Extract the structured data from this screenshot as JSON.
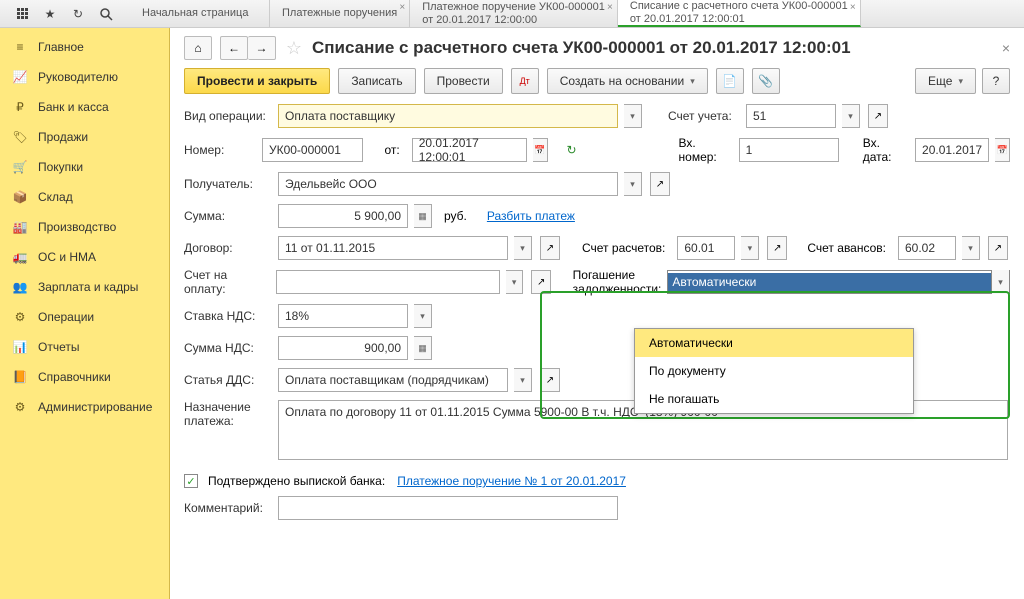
{
  "tabs": [
    {
      "line1": "Начальная страница"
    },
    {
      "line1": "Платежные поручения"
    },
    {
      "line1": "Платежное поручение УК00-000001",
      "line2": "от 20.01.2017 12:00:00"
    },
    {
      "line1": "Списание с расчетного счета УК00-000001",
      "line2": "от 20.01.2017 12:00:01"
    }
  ],
  "sidebar": [
    {
      "label": "Главное"
    },
    {
      "label": "Руководителю"
    },
    {
      "label": "Банк и касса"
    },
    {
      "label": "Продажи"
    },
    {
      "label": "Покупки"
    },
    {
      "label": "Склад"
    },
    {
      "label": "Производство"
    },
    {
      "label": "ОС и НМА"
    },
    {
      "label": "Зарплата и кадры"
    },
    {
      "label": "Операции"
    },
    {
      "label": "Отчеты"
    },
    {
      "label": "Справочники"
    },
    {
      "label": "Администрирование"
    }
  ],
  "title": "Списание с расчетного счета УК00-000001 от 20.01.2017 12:00:01",
  "toolbar": {
    "post_close": "Провести и закрыть",
    "save": "Записать",
    "post": "Провести",
    "create_by": "Создать на основании",
    "more": "Еще"
  },
  "form": {
    "op_type_label": "Вид операции:",
    "op_type": "Оплата поставщику",
    "account_label": "Счет учета:",
    "account": "51",
    "number_label": "Номер:",
    "number": "УК00-000001",
    "date_label": "от:",
    "date": "20.01.2017 12:00:01",
    "in_number_label": "Вх. номер:",
    "in_number": "1",
    "in_date_label": "Вх. дата:",
    "in_date": "20.01.2017",
    "recipient_label": "Получатель:",
    "recipient": "Эдельвейс ООО",
    "amount_label": "Сумма:",
    "amount": "5 900,00",
    "currency": "руб.",
    "split_link": "Разбить платеж",
    "contract_label": "Договор:",
    "contract": "11 от 01.11.2015",
    "settle_acc_label": "Счет расчетов:",
    "settle_acc": "60.01",
    "advance_acc_label": "Счет авансов:",
    "advance_acc": "60.02",
    "invoice_label": "Счет на оплату:",
    "debt_label1": "Погашение",
    "debt_label2": "задолженности:",
    "debt_value": "Автоматически",
    "debt_options": [
      "Автоматически",
      "По документу",
      "Не погашать"
    ],
    "vat_rate_label": "Ставка НДС:",
    "vat_rate": "18%",
    "vat_amount_label": "Сумма НДС:",
    "vat_amount": "900,00",
    "dds_label": "Статья ДДС:",
    "dds": "Оплата поставщикам (подрядчикам)",
    "purpose_label1": "Назначение",
    "purpose_label2": "платежа:",
    "purpose": "Оплата по договору 11 от 01.11.2015 Сумма 5900-00 В т.ч. НДС  (18%) 900-00",
    "confirmed_label": "Подтверждено выпиской банка:",
    "confirmed_link": "Платежное поручение № 1 от 20.01.2017",
    "comment_label": "Комментарий:"
  }
}
